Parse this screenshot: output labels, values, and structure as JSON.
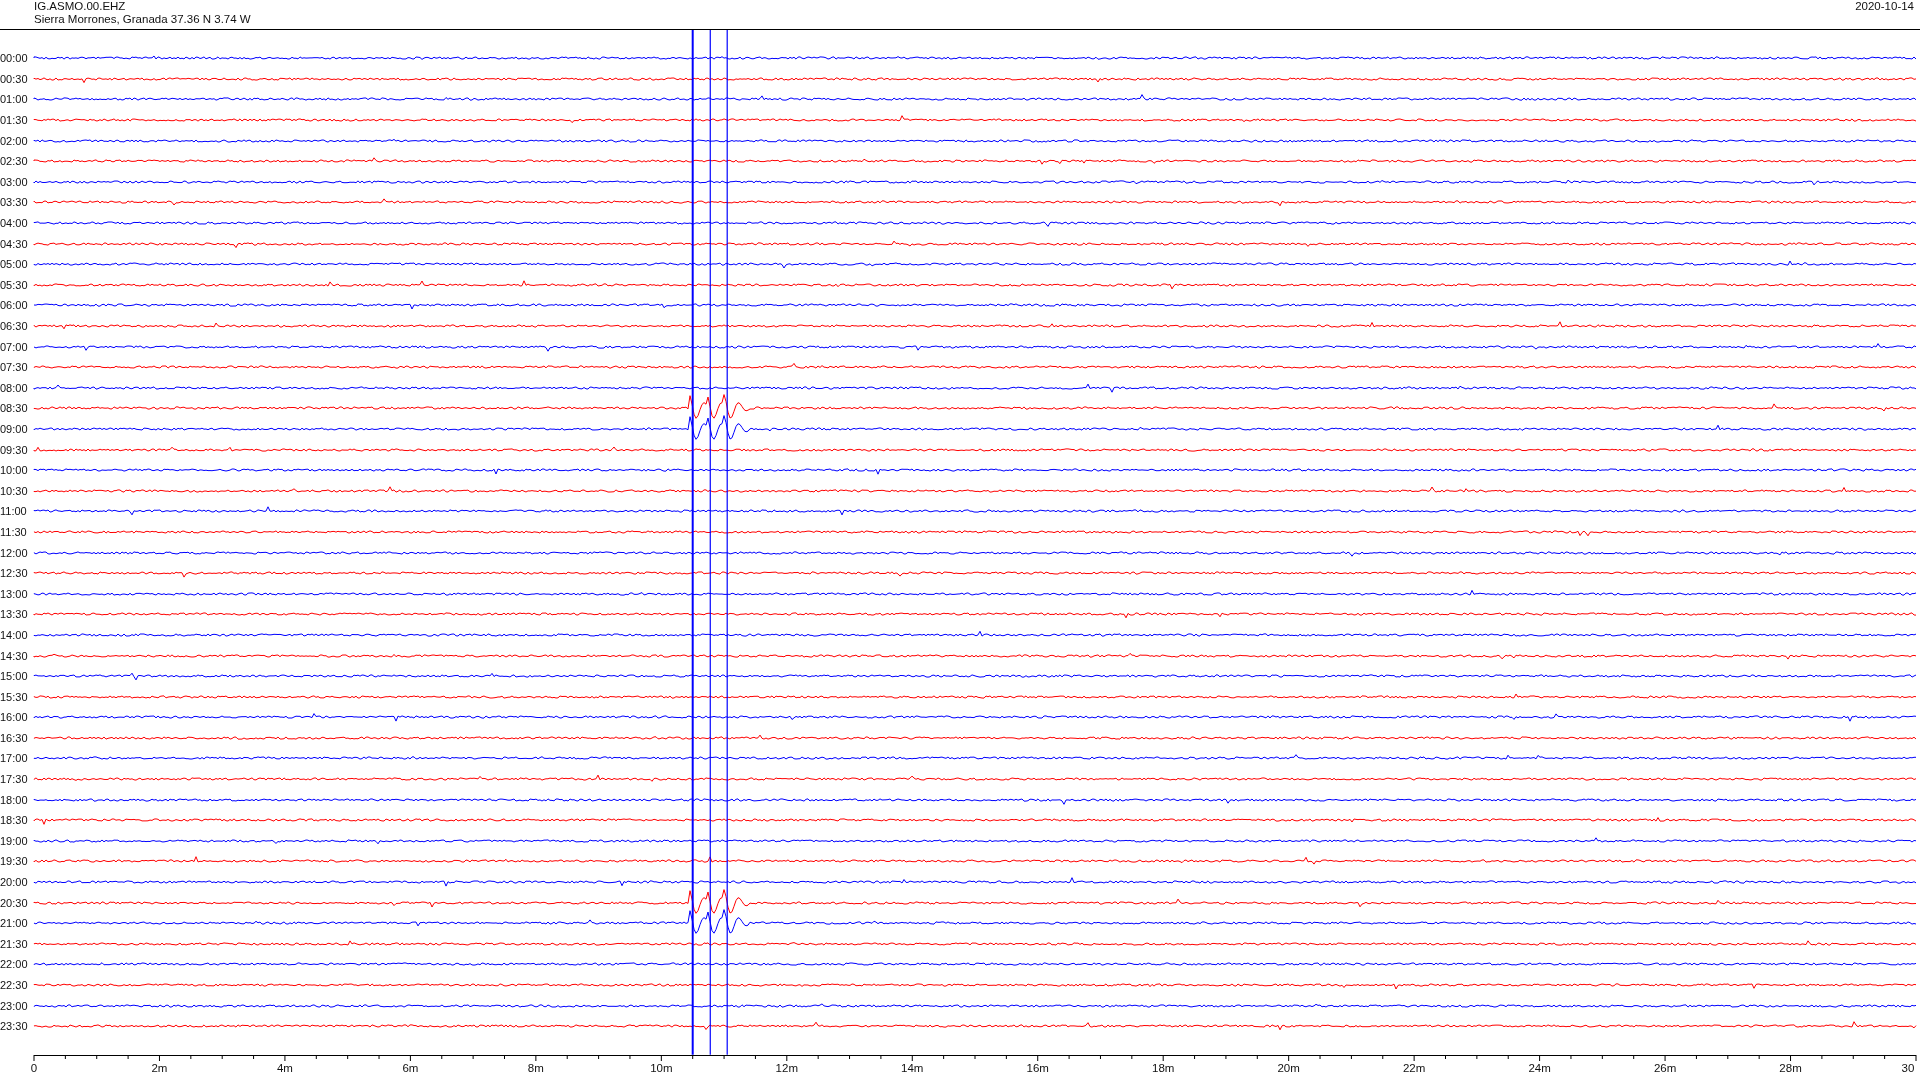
{
  "header": {
    "station": "IG.ASMO.00.EHZ",
    "location": "Sierra Morrones, Granada  37.36 N 3.74 W",
    "date": "2020-10-14"
  },
  "helicorder": {
    "rows": [
      {
        "label": "00:00",
        "color": "#0000ff"
      },
      {
        "label": "00:30",
        "color": "#ff0000"
      },
      {
        "label": "01:00",
        "color": "#0000ff"
      },
      {
        "label": "01:30",
        "color": "#ff0000"
      },
      {
        "label": "02:00",
        "color": "#0000ff"
      },
      {
        "label": "02:30",
        "color": "#ff0000"
      },
      {
        "label": "03:00",
        "color": "#0000ff"
      },
      {
        "label": "03:30",
        "color": "#ff0000"
      },
      {
        "label": "04:00",
        "color": "#0000ff"
      },
      {
        "label": "04:30",
        "color": "#ff0000"
      },
      {
        "label": "05:00",
        "color": "#0000ff"
      },
      {
        "label": "05:30",
        "color": "#ff0000"
      },
      {
        "label": "06:00",
        "color": "#0000ff"
      },
      {
        "label": "06:30",
        "color": "#ff0000"
      },
      {
        "label": "07:00",
        "color": "#0000ff"
      },
      {
        "label": "07:30",
        "color": "#ff0000"
      },
      {
        "label": "08:00",
        "color": "#0000ff"
      },
      {
        "label": "08:30",
        "color": "#ff0000"
      },
      {
        "label": "09:00",
        "color": "#0000ff"
      },
      {
        "label": "09:30",
        "color": "#ff0000"
      },
      {
        "label": "10:00",
        "color": "#0000ff"
      },
      {
        "label": "10:30",
        "color": "#ff0000"
      },
      {
        "label": "11:00",
        "color": "#0000ff"
      },
      {
        "label": "11:30",
        "color": "#ff0000"
      },
      {
        "label": "12:00",
        "color": "#0000ff"
      },
      {
        "label": "12:30",
        "color": "#ff0000"
      },
      {
        "label": "13:00",
        "color": "#0000ff"
      },
      {
        "label": "13:30",
        "color": "#ff0000"
      },
      {
        "label": "14:00",
        "color": "#0000ff"
      },
      {
        "label": "14:30",
        "color": "#ff0000"
      },
      {
        "label": "15:00",
        "color": "#0000ff"
      },
      {
        "label": "15:30",
        "color": "#ff0000"
      },
      {
        "label": "16:00",
        "color": "#0000ff"
      },
      {
        "label": "16:30",
        "color": "#ff0000"
      },
      {
        "label": "17:00",
        "color": "#0000ff"
      },
      {
        "label": "17:30",
        "color": "#ff0000"
      },
      {
        "label": "18:00",
        "color": "#0000ff"
      },
      {
        "label": "18:30",
        "color": "#ff0000"
      },
      {
        "label": "19:00",
        "color": "#0000ff"
      },
      {
        "label": "19:30",
        "color": "#ff0000"
      },
      {
        "label": "20:00",
        "color": "#0000ff"
      },
      {
        "label": "20:30",
        "color": "#ff0000"
      },
      {
        "label": "21:00",
        "color": "#0000ff"
      },
      {
        "label": "21:30",
        "color": "#ff0000"
      },
      {
        "label": "22:00",
        "color": "#0000ff"
      },
      {
        "label": "22:30",
        "color": "#ff0000"
      },
      {
        "label": "23:00",
        "color": "#0000ff"
      },
      {
        "label": "23:30",
        "color": "#ff0000"
      }
    ],
    "x_ticks": [
      "0",
      "2m",
      "4m",
      "6m",
      "8m",
      "10m",
      "12m",
      "14m",
      "16m",
      "18m",
      "20m",
      "22m",
      "24m",
      "26m",
      "28m",
      "30"
    ]
  }
}
